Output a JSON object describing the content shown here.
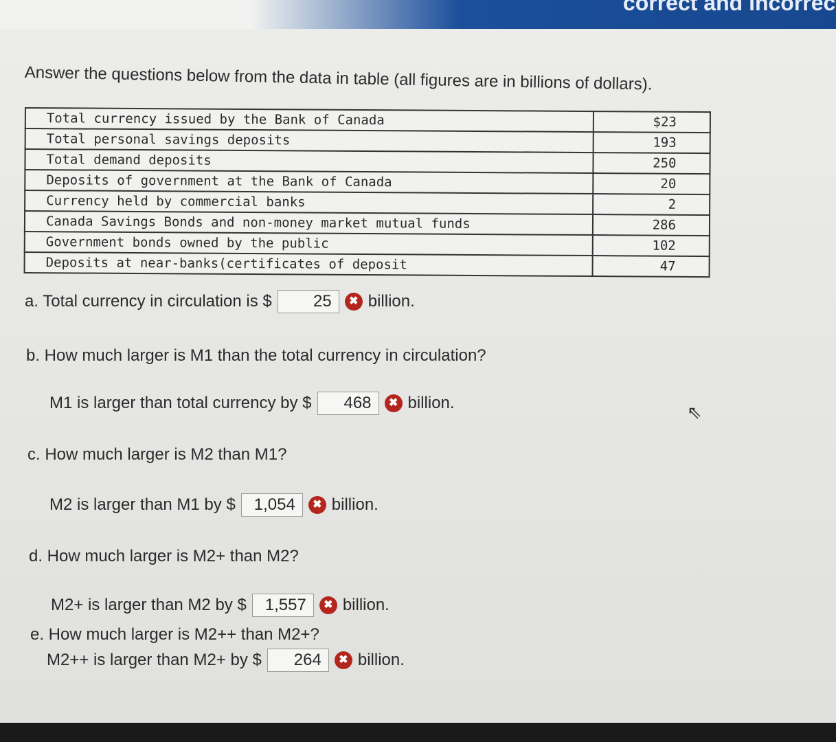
{
  "header": {
    "banner_text": "correct and incorrect"
  },
  "intro": "Answer the questions below from the data in table (all figures are in billions of dollars).",
  "table": [
    {
      "label": "Total currency issued by the Bank of Canada",
      "value": "$23"
    },
    {
      "label": "Total personal savings deposits",
      "value": "193"
    },
    {
      "label": "Total demand deposits",
      "value": "250"
    },
    {
      "label": "Deposits of government at the Bank of Canada",
      "value": "20"
    },
    {
      "label": "Currency held by commercial banks",
      "value": "2"
    },
    {
      "label": "Canada Savings Bonds and non-money market mutual funds",
      "value": "286"
    },
    {
      "label": "Government bonds owned by the public",
      "value": "102"
    },
    {
      "label": "Deposits at near-banks(certificates of deposit",
      "value": "47"
    }
  ],
  "questions": {
    "a": {
      "prefix": "a. Total currency in circulation is $",
      "answer": "25",
      "suffix": "billion.",
      "status": "incorrect"
    },
    "b": {
      "question": "b. How much larger is M1 than the total currency in circulation?",
      "prefix": "M1 is larger than total currency by $",
      "answer": "468",
      "suffix": "billion.",
      "status": "incorrect"
    },
    "c": {
      "question": "c. How much larger is M2 than M1?",
      "prefix": "M2 is larger than M1 by $",
      "answer": "1,054",
      "suffix": "billion.",
      "status": "incorrect"
    },
    "d": {
      "question": "d. How much larger is M2+ than M2?",
      "prefix": "M2+ is larger than M2 by $",
      "answer": "1,557",
      "suffix": "billion.",
      "status": "incorrect"
    },
    "e": {
      "question": "e. How much larger is M2++ than M2+?",
      "prefix": "M2++ is larger than M2+ by $",
      "answer": "264",
      "suffix": "billion.",
      "status": "incorrect"
    }
  },
  "icons": {
    "incorrect": "x-circle-icon",
    "cursor": "mouse-pointer-icon"
  },
  "colors": {
    "incorrect": "#b3261e",
    "banner": "#1b4f9c"
  }
}
